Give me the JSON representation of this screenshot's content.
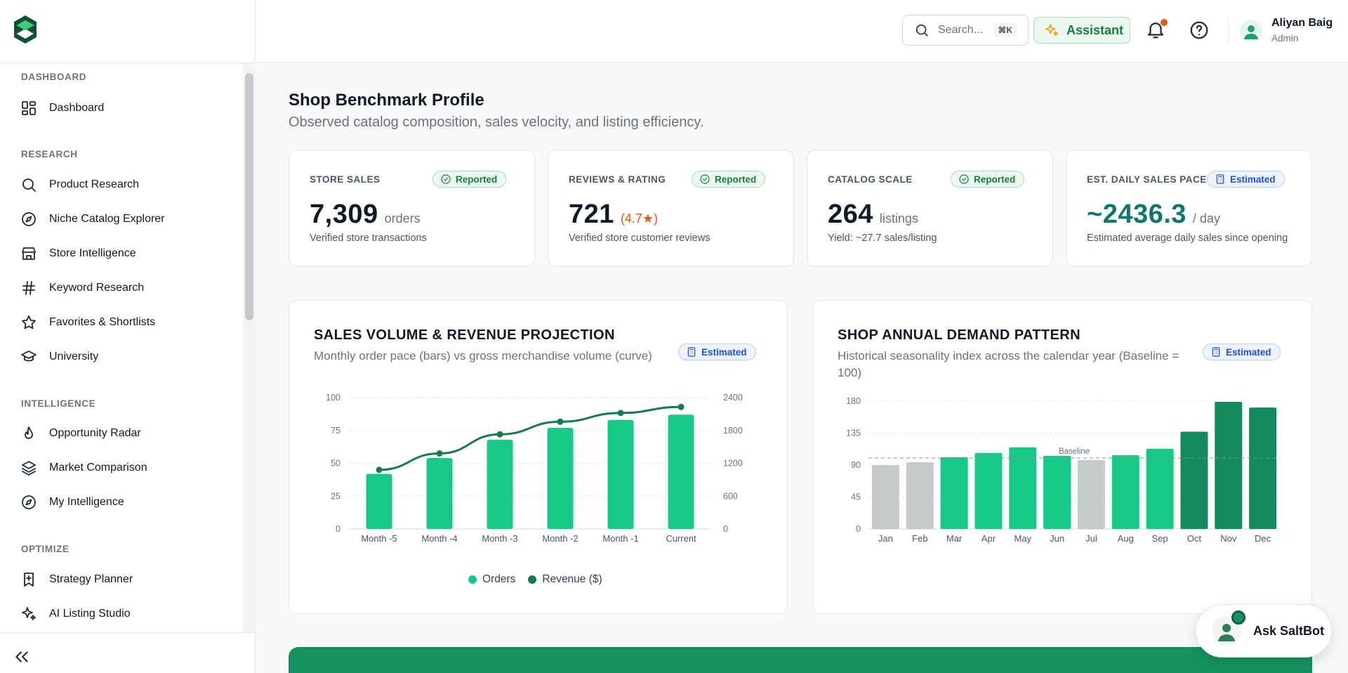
{
  "sidebar": {
    "sections": [
      {
        "label": "DASHBOARD",
        "items": [
          {
            "label": "Dashboard",
            "icon": "dashboard-icon"
          }
        ]
      },
      {
        "label": "RESEARCH",
        "items": [
          {
            "label": "Product Research",
            "icon": "search-icon"
          },
          {
            "label": "Niche Catalog Explorer",
            "icon": "compass-icon"
          },
          {
            "label": "Store Intelligence",
            "icon": "store-icon"
          },
          {
            "label": "Keyword Research",
            "icon": "hash-icon"
          },
          {
            "label": "Favorites & Shortlists",
            "icon": "star-icon"
          },
          {
            "label": "University",
            "icon": "graduation-cap-icon"
          }
        ]
      },
      {
        "label": "INTELLIGENCE",
        "items": [
          {
            "label": "Opportunity Radar",
            "icon": "flame-icon"
          },
          {
            "label": "Market Comparison",
            "icon": "layers-icon"
          },
          {
            "label": "My Intelligence",
            "icon": "compass-icon"
          }
        ]
      },
      {
        "label": "OPTIMIZE",
        "items": [
          {
            "label": "Strategy Planner",
            "icon": "bookmark-plus-icon"
          },
          {
            "label": "AI Listing Studio",
            "icon": "sparkles-icon"
          }
        ]
      }
    ]
  },
  "header": {
    "search": {
      "placeholder": "Search...",
      "shortcut": "⌘K"
    },
    "assistant_label": "Assistant",
    "user": {
      "name": "Aliyan Baig",
      "role": "Admin"
    }
  },
  "page": {
    "title": "Shop Benchmark Profile",
    "subtitle": "Observed catalog composition, sales velocity, and listing efficiency."
  },
  "stats": [
    {
      "label": "STORE SALES",
      "badge": "Reported",
      "value": "7,309",
      "unit": "orders",
      "desc": "Verified store transactions"
    },
    {
      "label": "REVIEWS & RATING",
      "badge": "Reported",
      "value": "721",
      "unit": "(4.7★)",
      "desc": "Verified store customer reviews"
    },
    {
      "label": "CATALOG SCALE",
      "badge": "Reported",
      "value": "264",
      "unit": "listings",
      "desc": "Yield: ~27.7 sales/listing"
    },
    {
      "label": "EST. DAILY SALES PACE",
      "badge": "Estimated",
      "value": "~2436.3",
      "unit": "/ day",
      "desc": "Estimated average daily sales since opening"
    }
  ],
  "colors": {
    "accent": "#15925f",
    "bar_light": "#17c987",
    "bar_dark": "#138a5e",
    "bar_gray": "#c7cbc7",
    "line": "#157a4f"
  },
  "chart_data": [
    {
      "type": "bar",
      "title": "SALES VOLUME & REVENUE PROJECTION",
      "subtitle": "Monthly order pace (bars) vs gross merchandise volume (curve)",
      "badge": "Estimated",
      "categories": [
        "Month -5",
        "Month -4",
        "Month -3",
        "Month -2",
        "Month -1",
        "Current"
      ],
      "series": [
        {
          "name": "Orders",
          "type": "bar",
          "axis": "left",
          "values": [
            42,
            54,
            68,
            77,
            83,
            87
          ]
        },
        {
          "name": "Revenue ($)",
          "type": "line",
          "axis": "right",
          "values": [
            1080,
            1380,
            1730,
            1960,
            2120,
            2230
          ]
        }
      ],
      "ylim": [
        0,
        100
      ],
      "yticks": [
        "0",
        "25",
        "50",
        "75",
        "100"
      ],
      "y2lim": [
        0,
        2400
      ],
      "y2ticks": [
        "0",
        "600",
        "1200",
        "1800",
        "2400"
      ],
      "grid": true,
      "legend": "bottom"
    },
    {
      "type": "bar",
      "title": "SHOP ANNUAL DEMAND PATTERN",
      "subtitle": "Historical seasonality index across the calendar year (Baseline = 100)",
      "badge": "Estimated",
      "categories": [
        "Jan",
        "Feb",
        "Mar",
        "Apr",
        "May",
        "Jun",
        "Jul",
        "Aug",
        "Sep",
        "Oct",
        "Nov",
        "Dec"
      ],
      "values": [
        90,
        94,
        101,
        107,
        115,
        103,
        97,
        104,
        113,
        137,
        179,
        171
      ],
      "ylim": [
        0,
        180
      ],
      "yticks": [
        "0",
        "45",
        "90",
        "135",
        "180"
      ],
      "baseline": 100,
      "baseline_label": "Baseline",
      "grid": true
    }
  ],
  "saltbot_label": "Ask SaltBot"
}
